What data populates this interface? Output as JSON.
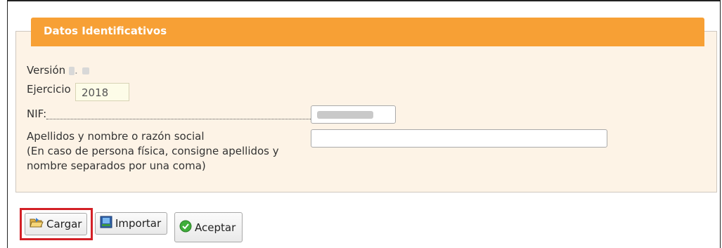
{
  "panel": {
    "title": "Datos Identificativos"
  },
  "version": {
    "label": "Versión",
    "separator": "."
  },
  "ejercicio": {
    "label": "Ejercicio",
    "value": "2018"
  },
  "nif": {
    "label": "NIF:",
    "value": ""
  },
  "nombre": {
    "label_line1": "Apellidos y nombre o razón social",
    "label_line2": "(En caso de persona física, consigne apellidos y",
    "label_line3": "nombre separados por una coma)",
    "value": ""
  },
  "buttons": {
    "cargar": "Cargar",
    "importar": "Importar",
    "aceptar": "Aceptar"
  },
  "colors": {
    "header": "#f7a035",
    "panel_bg": "#fdf3e6",
    "highlight": "#d32026"
  },
  "icons": {
    "cargar": "folder-open-icon",
    "importar": "import-icon",
    "aceptar": "check-circle-icon"
  }
}
